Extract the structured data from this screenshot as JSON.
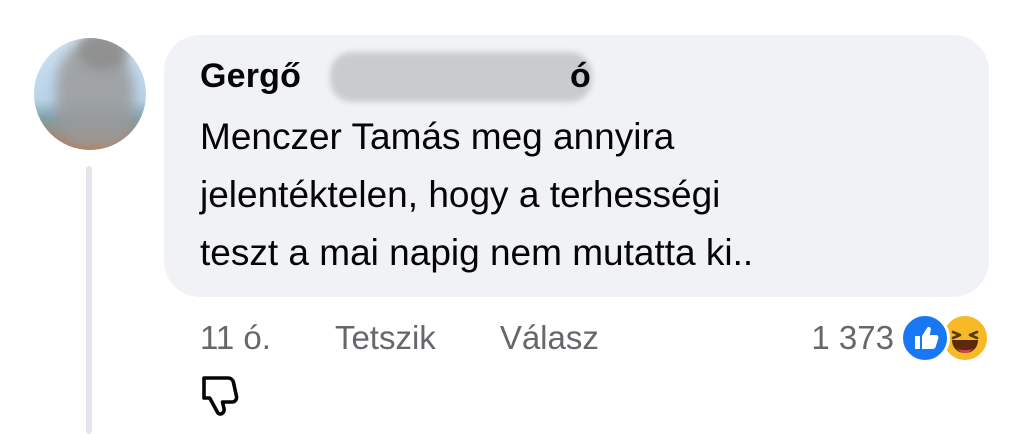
{
  "comment": {
    "author": "Gergő",
    "author_suffix": "ó",
    "text": "Menczer Tamás meg annyira\njelentéktelen, hogy a terhességi\nteszt a mai napig nem mutatta ki.."
  },
  "actions": {
    "time": "11 ó.",
    "like_label": "Tetszik",
    "reply_label": "Válasz"
  },
  "reactions": {
    "count": "1 373",
    "icons": [
      "like-icon",
      "haha-icon"
    ]
  },
  "icons": {
    "dislike": "thumbs-down-icon"
  },
  "colors": {
    "bubble": "#f0f2f5",
    "like_blue": "#1877f2",
    "haha_yellow": "#f7b928",
    "meta_gray": "#65676b"
  }
}
